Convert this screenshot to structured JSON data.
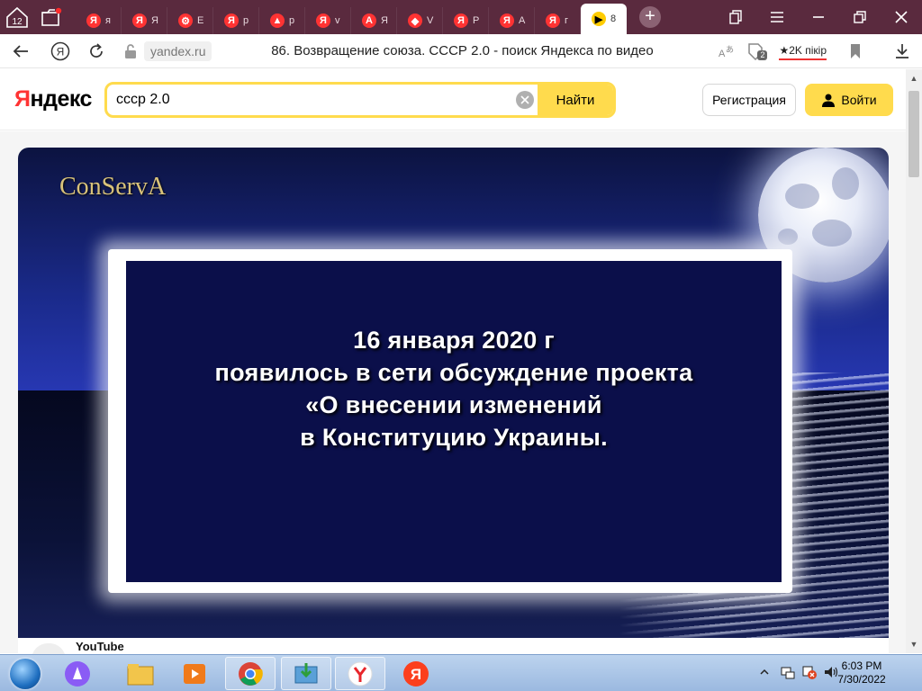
{
  "browser": {
    "tab_counter": "12",
    "tabs": [
      {
        "fav": "Я",
        "title": "я"
      },
      {
        "fav": "Я",
        "title": "Я"
      },
      {
        "fav": "⚙",
        "title": "Е"
      },
      {
        "fav": "Я",
        "title": "р"
      },
      {
        "fav": "▲",
        "title": "р"
      },
      {
        "fav": "Я",
        "title": "v"
      },
      {
        "fav": "A",
        "title": "Я"
      },
      {
        "fav": "◆",
        "title": "V"
      },
      {
        "fav": "Я",
        "title": "Р"
      },
      {
        "fav": "Я",
        "title": "А"
      },
      {
        "fav": "Я",
        "title": "г"
      }
    ],
    "active_tab": {
      "title": "8"
    },
    "new_tab": "+",
    "address": {
      "domain": "yandex.ru",
      "page_title": "86. Возвращение союза. СССР 2.0 - поиск Яндекса по видео",
      "reviews_label": "★2K пікір",
      "badge_count": "2"
    }
  },
  "yandex": {
    "logo_first": "Я",
    "logo_rest": "ндекс",
    "search_value": "ссср 2.0",
    "find_button": "Найти",
    "register_button": "Регистрация",
    "login_button": "Войти"
  },
  "video": {
    "watermark": "ConServA",
    "slide_lines": [
      "16 января 2020 г",
      "появилось в сети обсуждение проекта",
      "«О внесении изменений",
      "в Конституцию Украины."
    ],
    "source_label": "YouTube"
  },
  "taskbar": {
    "time": "6:03 PM",
    "date": "7/30/2022"
  },
  "colors": {
    "tabstrip": "#5a2a3e",
    "yandex_yellow": "#ffdb4d",
    "yandex_red": "#ff3333",
    "slide_bg": "#0b0f4a"
  }
}
